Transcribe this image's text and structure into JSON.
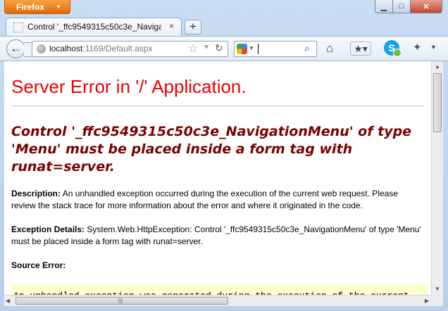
{
  "browser": {
    "app_button_label": "Firefox",
    "tab_title": "Control '_ffc9549315c50c3e_Navigation...",
    "tab_close_glyph": "×",
    "new_tab_glyph": "+",
    "url_host": "localhost",
    "url_rest": ":1169/Default.aspx",
    "search_value": "",
    "icons": {
      "back": "back-arrow-icon",
      "site": "globe-icon",
      "bookmark": "star-icon",
      "reload": "reload-icon",
      "search_engine": "google-icon",
      "search": "magnifier-icon",
      "home": "home-icon",
      "bookmarks_menu": "bookmarks-icon",
      "skype": "skype-icon",
      "addon": "addon-icon"
    }
  },
  "page": {
    "heading": "Server Error in '/' Application.",
    "error_message": "Control '_ffc9549315c50c3e_NavigationMenu' of type 'Menu' must be placed inside a form tag with runat=server.",
    "description_label": "Description:",
    "description_text": "An unhandled exception occurred during the execution of the current web request. Please review the stack trace for more information about the error and where it originated in the code.",
    "exception_label": "Exception Details:",
    "exception_text": "System.Web.HttpException: Control '_ffc9549315c50c3e_NavigationMenu' of type 'Menu' must be placed inside a form tag with runat=server.",
    "source_label": "Source Error:",
    "source_text": "An unhandled exception was generated during the execution of the current"
  },
  "colors": {
    "heading": "#e00000",
    "error_message": "#7a0000",
    "code_background": "#ffffcc"
  }
}
